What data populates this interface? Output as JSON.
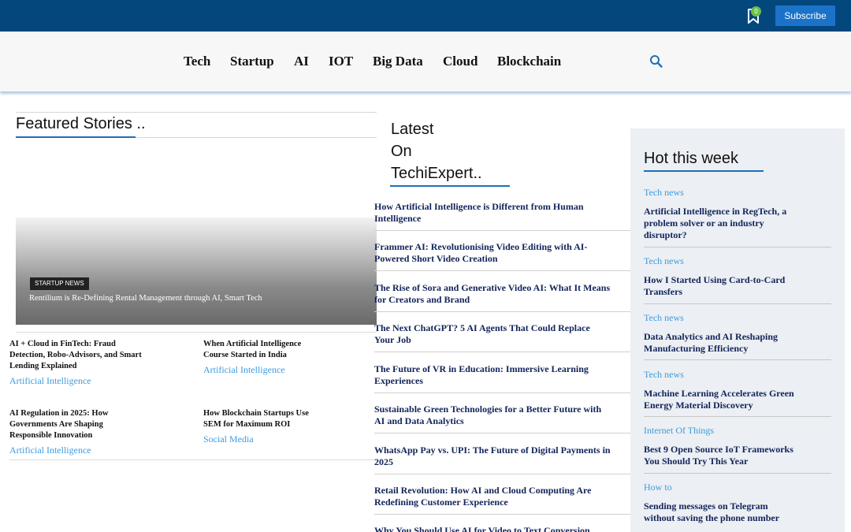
{
  "header": {
    "bookmark_count": "0",
    "subscribe_label": "Subscribe"
  },
  "nav": {
    "items": [
      "Tech",
      "Startup",
      "AI",
      "IOT",
      "Big Data",
      "Cloud",
      "Blockchain"
    ],
    "search_icon": "search-icon"
  },
  "featured": {
    "heading": "Featured Stories ..",
    "hero": {
      "tag": "STARTUP NEWS",
      "title": "Rentilium is Re-Defining Rental Management through AI, Smart Tech"
    },
    "cards": [
      {
        "title": "AI + Cloud in FinTech: Fraud Detection, Robo-Advisors, and Smart Lending Explained",
        "category": "Artificial Intelligence"
      },
      {
        "title": "When Artificial Intelligence Course Started in India",
        "category": "Artificial Intelligence"
      },
      {
        "title": "AI Regulation in 2025: How Governments Are Shaping Responsible Innovation",
        "category": "Artificial Intelligence"
      },
      {
        "title": "How Blockchain Startups Use SEM for Maximum ROI",
        "category": "Social Media"
      }
    ]
  },
  "latest": {
    "heading_line1": "Latest",
    "heading_line2": "On",
    "heading_line3": "TechiExpert..",
    "items": [
      "How Artificial Intelligence is Different from Human Intelligence",
      "Frammer AI: Revolutionising Video Editing with AI-Powered Short Video Creation",
      "The Rise of Sora and Generative Video AI: What It Means for Creators and Brand",
      "The Next ChatGPT? 5 AI Agents That Could Replace Your Job",
      "The Future of VR in Education: Immersive Learning Experiences",
      "Sustainable Green Technologies for a Better Future with AI and Data Analytics",
      "WhatsApp Pay vs. UPI: The Future of Digital Payments in 2025",
      "Retail Revolution: How AI and Cloud Computing Are Redefining Customer Experience",
      "Why You Should Use AI for Video to Text Conversion"
    ]
  },
  "hot": {
    "heading": "Hot this week",
    "items": [
      {
        "category": "Tech news",
        "title": "Artificial Intelligence in RegTech, a problem solver or an industry disruptor?"
      },
      {
        "category": "Tech news",
        "title": "How I Started Using Card-to-Card Transfers"
      },
      {
        "category": "Tech news",
        "title": "Data Analytics and AI Reshaping Manufacturing Efficiency"
      },
      {
        "category": "Tech news",
        "title": "Machine Learning Accelerates Green Energy Material Discovery"
      },
      {
        "category": "Internet Of Things",
        "title": "Best 9 Open Source IoT Frameworks You Should Try This Year"
      },
      {
        "category": "How to",
        "title": "Sending messages on Telegram without saving the phone number"
      }
    ]
  },
  "colors": {
    "topbar": "#04477d",
    "accent": "#1e6fb8",
    "category": "#3d9be0",
    "subscribe": "#1a73c9",
    "badge": "#6cc04a"
  }
}
